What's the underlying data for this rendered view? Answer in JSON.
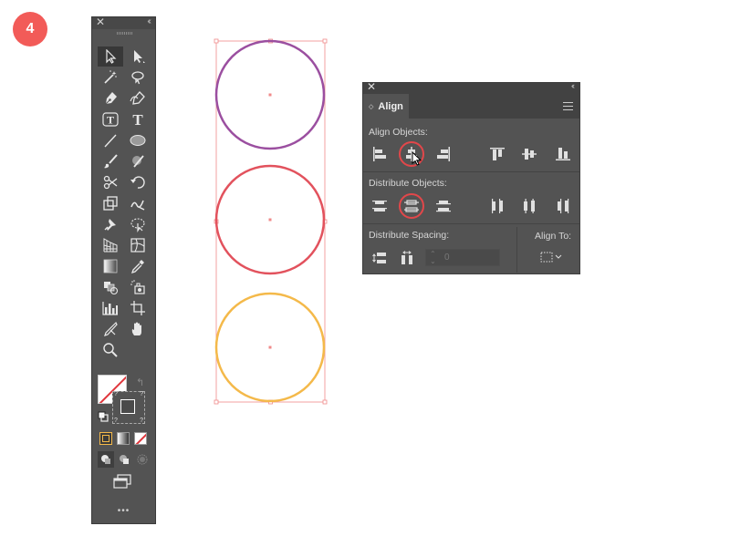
{
  "step": {
    "number": "4",
    "color": "#f25b58"
  },
  "tools_panel": {
    "tools": [
      "selection-tool",
      "direct-selection-tool",
      "magic-wand-tool",
      "lasso-tool",
      "pen-tool",
      "curvature-tool",
      "touch-type-tool",
      "type-tool",
      "line-segment-tool",
      "ellipse-tool",
      "paintbrush-tool",
      "shaper-tool",
      "scissors-tool",
      "rotate-tool",
      "scale-tool",
      "warp-tool",
      "puppet-warp-tool",
      "free-transform-tool",
      "perspective-grid-tool",
      "mesh-tool",
      "gradient-tool",
      "eyedropper-tool",
      "blend-tool",
      "symbol-sprayer-tool",
      "column-graph-tool",
      "artboard-tool",
      "slice-tool",
      "hand-tool",
      "zoom-tool"
    ],
    "more_label": "•••"
  },
  "canvas": {
    "circles": [
      {
        "name": "purple-circle",
        "color": "#9b4fa0"
      },
      {
        "name": "red-circle",
        "color": "#e2525d"
      },
      {
        "name": "yellow-circle",
        "color": "#f4b94a"
      }
    ],
    "selection_color": "#f08a8a"
  },
  "align_panel": {
    "tab_label": "Align",
    "align_objects_label": "Align Objects:",
    "distribute_objects_label": "Distribute Objects:",
    "distribute_spacing_label": "Distribute Spacing:",
    "align_to_label": "Align To:",
    "spacing_value": "0",
    "highlight_color": "#e2474a"
  }
}
